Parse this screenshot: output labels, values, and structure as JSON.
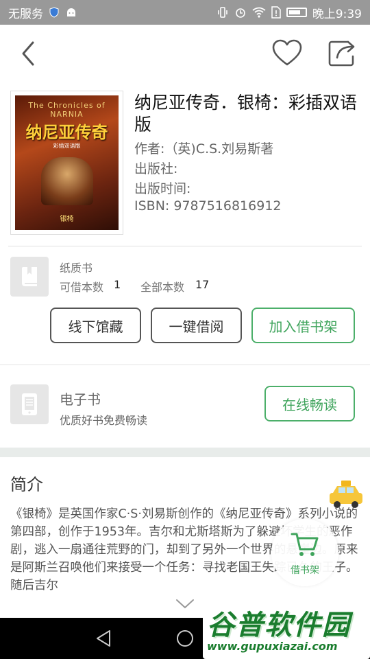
{
  "status_bar": {
    "carrier": "无服务",
    "time": "晚上9:39"
  },
  "book": {
    "title": "纳尼亚传奇．银椅：彩插双语版",
    "author": "作者:（英)C.S.刘易斯著",
    "publisher": "出版社:",
    "publish_date": "出版时间:",
    "isbn": "ISBN:   9787516816912",
    "cover": {
      "series": "The Chronicles of NARNIA",
      "title": "纳尼亚传奇",
      "subtitle": "彩插双语版",
      "bottom": "银椅"
    }
  },
  "paper_book": {
    "type_label": "纸质书",
    "available_label": "可借本数",
    "available_count": "1",
    "total_label": "全部本数",
    "total_count": "17",
    "buttons": {
      "offline": "线下馆藏",
      "borrow": "一键借阅",
      "add_shelf": "加入借书架"
    }
  },
  "ebook": {
    "title": "电子书",
    "desc": "优质好书免费畅读",
    "read_button": "在线畅读"
  },
  "intro": {
    "heading": "简介",
    "text": "《银椅》是英国作家C·S·刘易斯创作的《纳尼亚传奇》系列小说的第四部，创作于1953年。吉尔和尤斯塔斯为了躲避坏学生的恶作剧，逃入一扇通往荒野的门，却到了另外一个世界的悬崖边。原来是阿斯兰召唤他们来接受一个任务：寻找老国王失踪已久的王子。随后吉尔"
  },
  "cart_fab": {
    "label": "借书架"
  },
  "watermark": {
    "title": "谷普软件园",
    "url": "www.gupuxiazai.com"
  },
  "colors": {
    "accent_green": "#3fa45c",
    "status_bar": "#999999"
  },
  "icons": [
    "back-icon",
    "heart-icon",
    "share-icon",
    "paper-book-icon",
    "ebook-icon",
    "chevron-down-icon",
    "taxi-icon",
    "cart-icon"
  ]
}
